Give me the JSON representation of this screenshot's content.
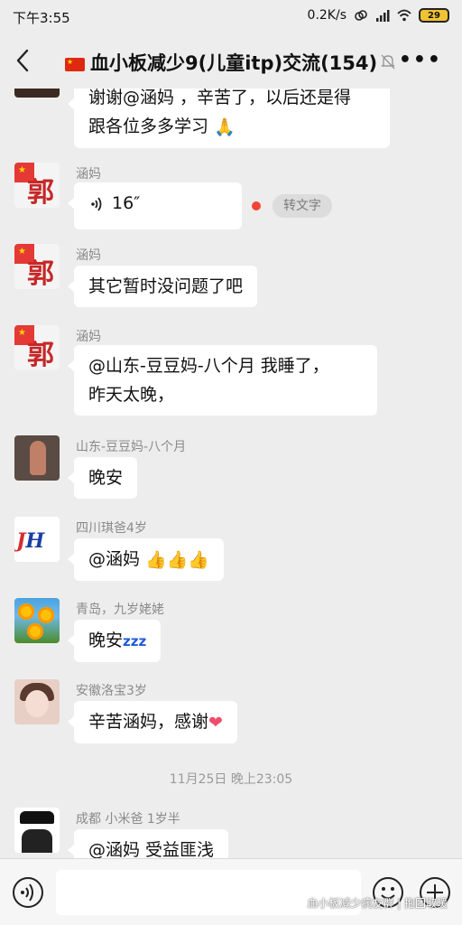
{
  "status_bar": {
    "time": "下午3:55",
    "network_speed": "0.2K/s",
    "battery": "29"
  },
  "header": {
    "title": "血小板减少9(儿童itp)交流(154)"
  },
  "messages": [
    {
      "text_line1": "谢谢@涵妈 ，辛苦了，以后还是得",
      "text_line2": "跟各位多多学习"
    },
    {
      "sender": "涵妈",
      "voice_duration": "16″",
      "to_text_label": "转文字"
    },
    {
      "sender": "涵妈",
      "text": "其它暂时没问题了吧"
    },
    {
      "sender": "涵妈",
      "text_line1": "@山东-豆豆妈-八个月  我睡了，",
      "text_line2": "昨天太晚，"
    },
    {
      "sender": "山东-豆豆妈-八个月",
      "text": "晚安"
    },
    {
      "sender": "四川琪爸4岁",
      "text": "@涵妈"
    },
    {
      "sender": "青岛，九岁姥姥",
      "text": "晚安"
    },
    {
      "sender": "安徽洛宝3岁",
      "text": "辛苦涵妈，感谢"
    },
    {
      "sender": "成都 小米爸 1岁半",
      "text": "@涵妈  受益匪浅"
    }
  ],
  "timestamp": "11月25日 晚上23:05",
  "avatars": {
    "guo_char": "郭",
    "jh_logo_j": "J",
    "jh_logo_h": "H"
  },
  "watermark": "血小板减少病友群 | 抱团取暖",
  "colors": {
    "background": "#ededed",
    "bubble": "#ffffff",
    "sender_name": "#8a8a8a",
    "red_dot": "#f44336"
  }
}
